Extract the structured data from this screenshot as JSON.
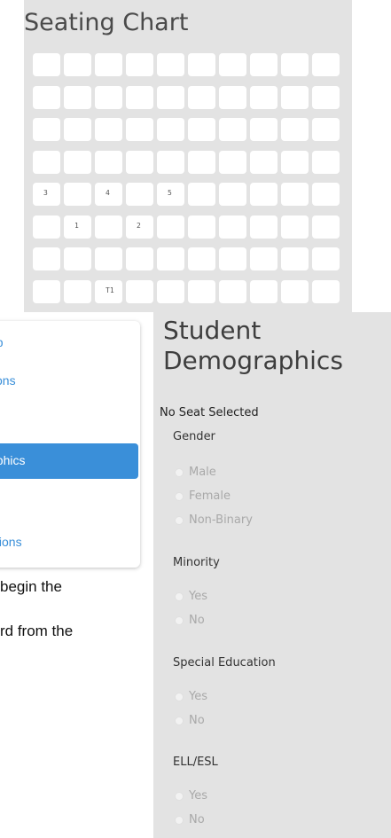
{
  "seating_chart": {
    "title": "Seating Chart",
    "seat_labels": [
      {
        "row": 4,
        "col": 0,
        "label": "3"
      },
      {
        "row": 4,
        "col": 2,
        "label": "4"
      },
      {
        "row": 4,
        "col": 4,
        "label": "5"
      },
      {
        "row": 5,
        "col": 1,
        "label": "1"
      },
      {
        "row": 5,
        "col": 3,
        "label": "2"
      },
      {
        "row": 7,
        "col": 2,
        "label": "T1"
      }
    ]
  },
  "nav": {
    "items": [
      {
        "label": "up",
        "active": false
      },
      {
        "label": "tions",
        "active": false
      },
      {
        "label": "",
        "active": false
      },
      {
        "label": "aphics",
        "active": true
      },
      {
        "label": "s",
        "active": false
      },
      {
        "label": "stions",
        "active": false
      }
    ]
  },
  "body_text": {
    "line1": " begin the",
    "line2": "rd from the"
  },
  "demographics": {
    "title_line1": "Student",
    "title_line2": "Demographics",
    "status": "No Seat Selected",
    "groups": [
      {
        "label": "Gender",
        "options": [
          "Male",
          "Female",
          "Non-Binary"
        ]
      },
      {
        "label": "Minority",
        "options": [
          "Yes",
          "No"
        ]
      },
      {
        "label": "Special Education",
        "options": [
          "Yes",
          "No"
        ]
      },
      {
        "label": "ELL/ESL",
        "options": [
          "Yes",
          "No"
        ]
      }
    ]
  }
}
